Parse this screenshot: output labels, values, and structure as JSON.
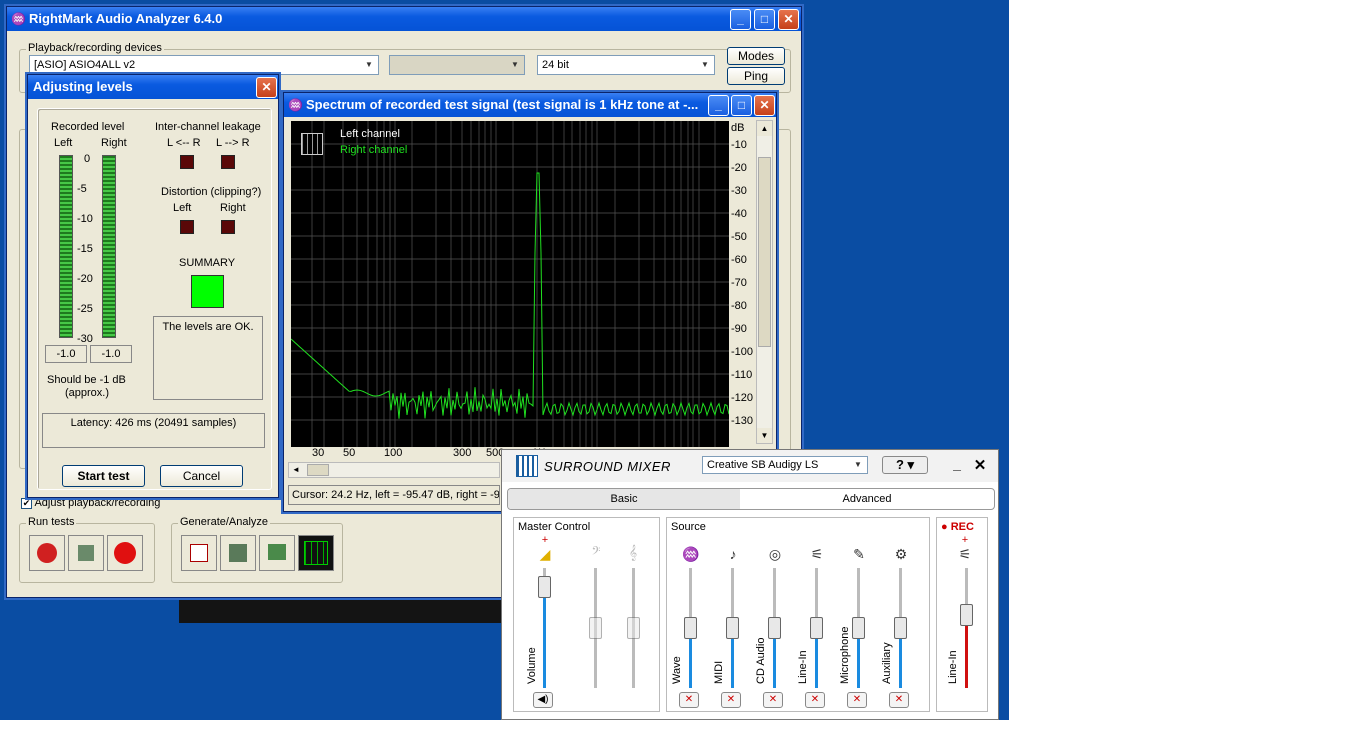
{
  "main_window": {
    "title": "RightMark Audio Analyzer 6.4.0",
    "devices_group": "Playback/recording devices",
    "device": "[ASIO] ASIO4ALL v2",
    "bits": "24 bit",
    "modes_button": "Modes",
    "ping_button": "Ping",
    "adjust_checkbox": "Adjust playback/recording",
    "run_tests_group": "Run tests",
    "generate_group": "Generate/Analyze"
  },
  "levels": {
    "title": "Adjusting levels",
    "recorded_level": "Recorded level",
    "left": "Left",
    "right": "Right",
    "scale": [
      "0",
      "-5",
      "-10",
      "-15",
      "-20",
      "-25",
      "-30"
    ],
    "left_value": "-1.0",
    "right_value": "-1.0",
    "should_be": "Should be  -1 dB",
    "approx": "(approx.)",
    "leakage": "Inter-channel leakage",
    "l_from_r": "L <-- R",
    "l_to_r": "L --> R",
    "distortion": "Distortion (clipping?)",
    "dist_left": "Left",
    "dist_right": "Right",
    "summary": "SUMMARY",
    "summary_color": "#00ff00",
    "message": "The levels are OK.",
    "latency": "Latency: 426 ms (20491 samples)",
    "start": "Start test",
    "cancel": "Cancel"
  },
  "spectrum": {
    "title": "Spectrum of recorded test signal (test signal is 1 kHz tone at -...",
    "legend_left": "Left channel",
    "legend_right": "Right channel",
    "db_unit": "dB",
    "y_ticks": [
      "-10",
      "-20",
      "-30",
      "-40",
      "-50",
      "-60",
      "-70",
      "-80",
      "-90",
      "-100",
      "-110",
      "-120",
      "-130"
    ],
    "x_ticks": [
      "30",
      "50",
      "100",
      "300",
      "500",
      "1K"
    ],
    "cursor": "Cursor:  24.2 Hz,  left = -95.47 dB,  right = -9"
  },
  "mixer": {
    "title": "SURROUND MIXER",
    "device": "Creative SB Audigy LS",
    "help": "?",
    "tab_basic": "Basic",
    "tab_advanced": "Advanced",
    "master": "Master Control",
    "master_label": "Volume",
    "source": "Source",
    "sources": [
      "Wave",
      "MIDI",
      "CD Audio",
      "Line-In",
      "Microphone",
      "Auxiliary"
    ],
    "rec": "REC",
    "rec_label": "Line-In"
  }
}
